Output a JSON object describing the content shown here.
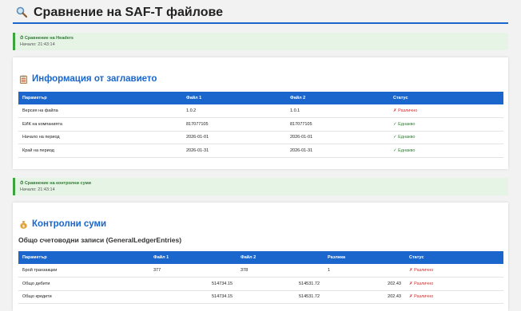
{
  "page": {
    "title": "Сравнение на SAF-T файлове",
    "icon": "magnifier-icon"
  },
  "status_headers": {
    "title": "⏱ Сравнение на Headers",
    "subtitle": "Начало: 21:43:14"
  },
  "header_section": {
    "title": "Информация от заглавието",
    "icon": "clipboard-icon",
    "columns": [
      "Параметър",
      "Файл 1",
      "Файл 2",
      "Статус"
    ],
    "rows": [
      {
        "param": "Версия на файла",
        "file1": "1.0.2",
        "file2": "1.0.1",
        "status": "✗ Различно",
        "status_kind": "diff"
      },
      {
        "param": "ЕИК на компанията",
        "file1": "817077105",
        "file2": "817077105",
        "status": "✓ Еднакво",
        "status_kind": "same"
      },
      {
        "param": "Начало на период",
        "file1": "2026-01-01",
        "file2": "2026-01-01",
        "status": "✓ Еднакво",
        "status_kind": "same"
      },
      {
        "param": "Край на период",
        "file1": "2026-01-31",
        "file2": "2026-01-31",
        "status": "✓ Еднакво",
        "status_kind": "same"
      }
    ]
  },
  "status_checksums": {
    "title": "⏱ Сравнение на контролни суми",
    "subtitle": "Начало: 21:43:14"
  },
  "checksums_section": {
    "title": "Контролни суми",
    "icon": "money-bag-icon",
    "subtitle": "Общо счетоводни записи (GeneralLedgerEntries)",
    "columns": [
      "Параметър",
      "Файл 1",
      "Файл 2",
      "Разлика",
      "Статус"
    ],
    "rows": [
      {
        "param": "Брой транзакции",
        "file1": "377",
        "file2": "378",
        "diff": "1",
        "status": "✗ Различно",
        "status_kind": "diff"
      },
      {
        "param": "Общо дебити",
        "file1": "514734.15",
        "file2": "514531.72",
        "diff": "202.43",
        "status": "✗ Различно",
        "status_kind": "diff"
      },
      {
        "param": "Общо кредити",
        "file1": "514734.15",
        "file2": "514531.72",
        "diff": "202.43",
        "status": "✗ Различно",
        "status_kind": "diff"
      }
    ]
  },
  "colors": {
    "accent": "#1a66cc",
    "success": "#2e7d32",
    "error": "#d32f2f",
    "status_bg": "#e6f4e6"
  }
}
